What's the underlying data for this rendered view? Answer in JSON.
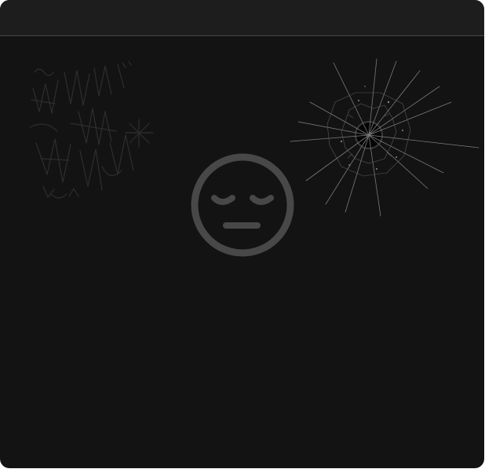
{
  "window": {
    "background": "#131313",
    "titlebar_color": "#1d1d1d"
  },
  "status": {
    "icon": "sad-face-icon",
    "icon_color": "#484848"
  },
  "decorations": {
    "left": "graffiti-scribble-icon",
    "right": "cracked-glass-icon"
  }
}
